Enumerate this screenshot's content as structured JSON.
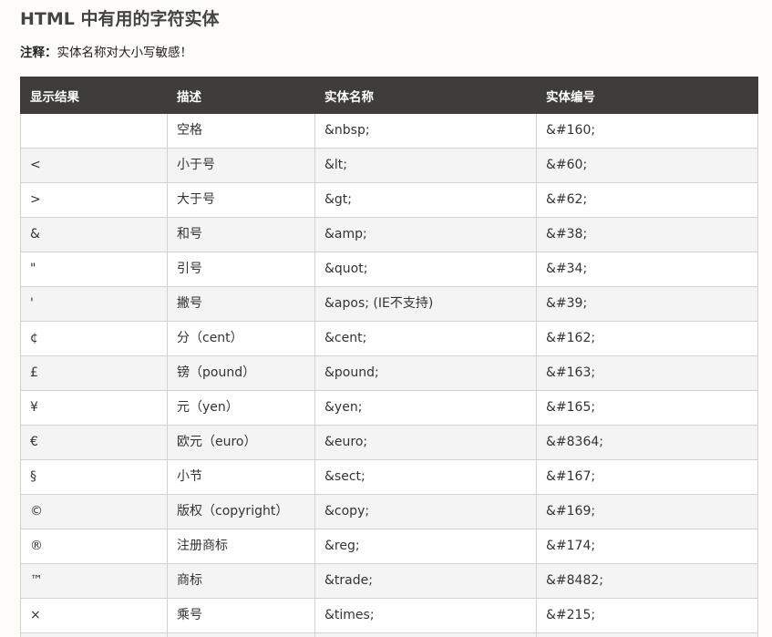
{
  "page": {
    "title": "HTML 中有用的字符实体",
    "note_label": "注释：",
    "note_text": "实体名称对大小写敏感！"
  },
  "table": {
    "headers": [
      "显示结果",
      "描述",
      "实体名称",
      "实体编号"
    ],
    "rows": [
      {
        "result": "",
        "desc": "空格",
        "name": "&nbsp;",
        "number": "&#160;"
      },
      {
        "result": "<",
        "desc": "小于号",
        "name": "&lt;",
        "number": "&#60;"
      },
      {
        "result": ">",
        "desc": "大于号",
        "name": "&gt;",
        "number": "&#62;"
      },
      {
        "result": "&",
        "desc": "和号",
        "name": "&amp;",
        "number": "&#38;"
      },
      {
        "result": "\"",
        "desc": "引号",
        "name": "&quot;",
        "number": "&#34;"
      },
      {
        "result": "'",
        "desc": "撇号",
        "name": "&apos; (IE不支持)",
        "number": "&#39;"
      },
      {
        "result": "¢",
        "desc": "分（cent）",
        "name": "&cent;",
        "number": "&#162;"
      },
      {
        "result": "£",
        "desc": "镑（pound）",
        "name": "&pound;",
        "number": "&#163;"
      },
      {
        "result": "¥",
        "desc": "元（yen）",
        "name": "&yen;",
        "number": "&#165;"
      },
      {
        "result": "€",
        "desc": "欧元（euro）",
        "name": "&euro;",
        "number": "&#8364;"
      },
      {
        "result": "§",
        "desc": "小节",
        "name": "&sect;",
        "number": "&#167;"
      },
      {
        "result": "©",
        "desc": "版权（copyright）",
        "name": "&copy;",
        "number": "&#169;"
      },
      {
        "result": "®",
        "desc": "注册商标",
        "name": "&reg;",
        "number": "&#174;"
      },
      {
        "result": "™",
        "desc": "商标",
        "name": "&trade;",
        "number": "&#8482;"
      },
      {
        "result": "×",
        "desc": "乘号",
        "name": "&times;",
        "number": "&#215;"
      },
      {
        "result": "",
        "desc": "",
        "name": "",
        "number": ""
      }
    ]
  }
}
